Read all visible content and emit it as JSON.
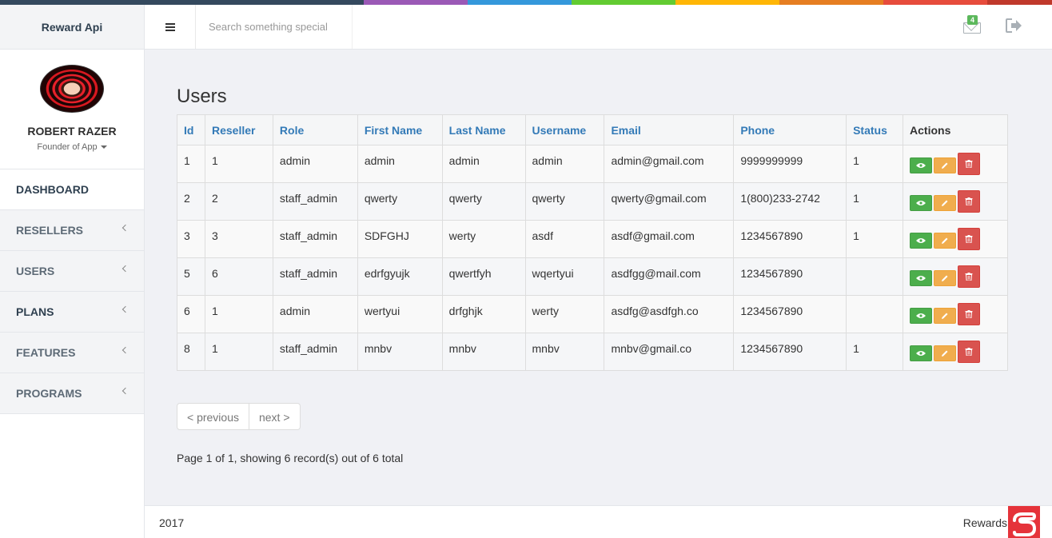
{
  "colors": {
    "rainbow": [
      "#34495e",
      "#34495e",
      "#9b59b6",
      "#3498db",
      "#62cb31",
      "#ffb606",
      "#e67e22",
      "#e74c3c",
      "#c0392b"
    ],
    "accent": "#337ab7",
    "view_btn": "#5cb85c",
    "edit_btn": "#f0ad4e",
    "delete_btn": "#d9534f"
  },
  "brand": {
    "name": "Reward Api"
  },
  "topbar": {
    "search_placeholder": "Search something special",
    "mail_badge": "4"
  },
  "profile": {
    "name": "ROBERT RAZER",
    "role": "Founder of App"
  },
  "nav": [
    {
      "label": "DASHBOARD",
      "has_submenu": false
    },
    {
      "label": "RESELLERS",
      "has_submenu": true
    },
    {
      "label": "USERS",
      "has_submenu": true
    },
    {
      "label": "PLANS",
      "has_submenu": true
    },
    {
      "label": "FEATURES",
      "has_submenu": true
    },
    {
      "label": "PROGRAMS",
      "has_submenu": true
    }
  ],
  "page": {
    "title": "Users"
  },
  "table": {
    "columns": [
      "Id",
      "Reseller",
      "Role",
      "First Name",
      "Last Name",
      "Username",
      "Email",
      "Phone",
      "Status",
      "Actions"
    ],
    "rows": [
      [
        "1",
        "1",
        "admin",
        "admin",
        "admin",
        "admin",
        "admin@gmail.com",
        "9999999999",
        "1"
      ],
      [
        "2",
        "2",
        "staff_admin",
        "qwerty",
        "qwerty",
        "qwerty",
        "qwerty@gmail.com",
        "1(800)233-2742",
        "1"
      ],
      [
        "3",
        "3",
        "staff_admin",
        "SDFGHJ",
        "werty",
        "asdf",
        "asdf@gmail.com",
        "1234567890",
        "1"
      ],
      [
        "5",
        "6",
        "staff_admin",
        "edrfgyujk",
        "qwertfyh",
        "wqertyui",
        "asdfgg@mail.com",
        "1234567890",
        ""
      ],
      [
        "6",
        "1",
        "admin",
        "wertyui",
        "drfghjk",
        "werty",
        "asdfg@asdfgh.co",
        "1234567890",
        ""
      ],
      [
        "8",
        "1",
        "staff_admin",
        "mnbv",
        "mnbv",
        "mnbv",
        "mnbv@gmail.co",
        "1234567890",
        "1"
      ]
    ]
  },
  "pagination": {
    "previous_label": "< previous",
    "next_label": "next >"
  },
  "page_info": "Page 1 of 1, showing 6 record(s) out of 6 total",
  "footer": {
    "year": "2017",
    "brand": "Rewards"
  }
}
